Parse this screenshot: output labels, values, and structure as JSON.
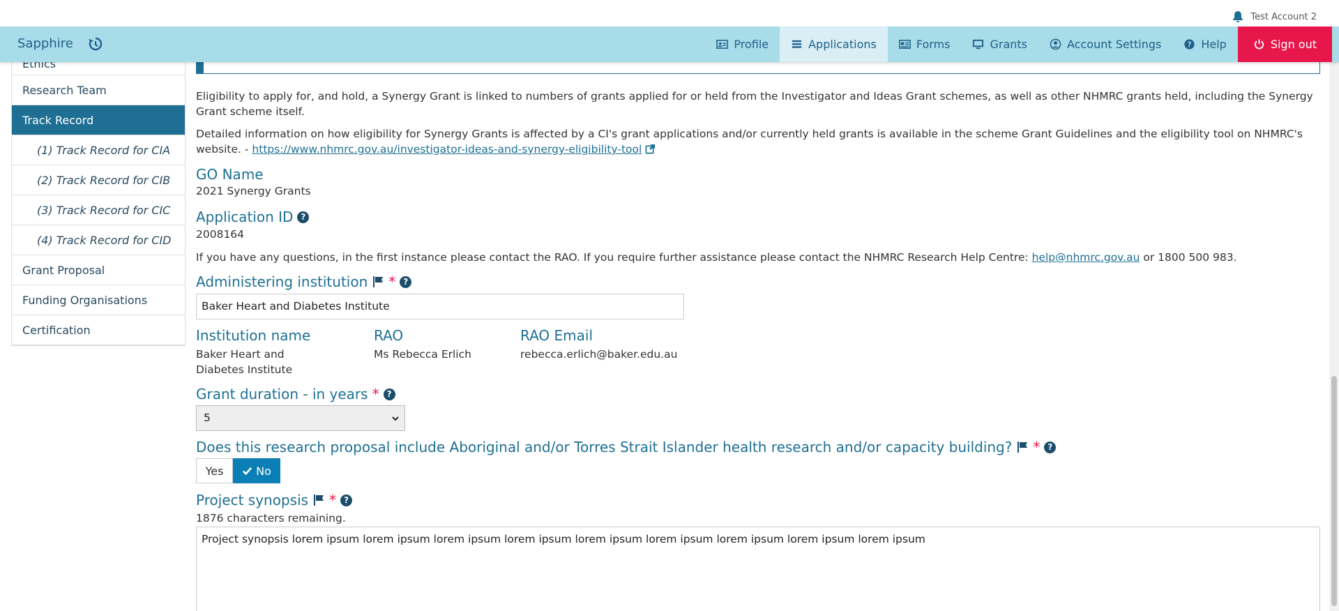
{
  "account": {
    "name": "Test Account 2"
  },
  "header": {
    "brand": "Sapphire",
    "nav": [
      {
        "label": "Profile",
        "icon": "id-card-icon"
      },
      {
        "label": "Applications",
        "icon": "list-icon"
      },
      {
        "label": "Forms",
        "icon": "newspaper-icon"
      },
      {
        "label": "Grants",
        "icon": "monitor-icon"
      },
      {
        "label": "Account Settings",
        "icon": "user-circle-icon"
      },
      {
        "label": "Help",
        "icon": "question-icon"
      },
      {
        "label": "Sign out",
        "icon": "power-icon"
      }
    ]
  },
  "sidebar": {
    "items": [
      {
        "label": "Ethics"
      },
      {
        "label": "Research Team"
      },
      {
        "label": "Track Record"
      },
      {
        "label": "(1) Track Record for CIA"
      },
      {
        "label": "(2) Track Record for CIB"
      },
      {
        "label": "(3) Track Record for CIC"
      },
      {
        "label": "(4) Track Record for CID"
      },
      {
        "label": "Grant Proposal"
      },
      {
        "label": "Funding Organisations"
      },
      {
        "label": "Certification"
      }
    ]
  },
  "main": {
    "eligibility_para": "Eligibility to apply for, and hold, a Synergy Grant is linked to numbers of grants applied for or held from the Investigator and Ideas Grant schemes, as well as other NHMRC grants held, including the Synergy Grant scheme itself.",
    "detail_para": "Detailed information on how eligibility for Synergy Grants is affected by a CI's grant applications and/or currently held grants is available in the scheme Grant Guidelines and the eligibility tool on NHMRC's website. - ",
    "eligibility_link": "https://www.nhmrc.gov.au/investigator-ideas-and-synergy-eligibility-tool",
    "go_name_label": "GO Name",
    "go_name_value": "2021 Synergy Grants",
    "app_id_label": "Application ID",
    "app_id_value": "2008164",
    "contact_pre": "If you have any questions, in the first instance please contact the RAO. If you require further assistance please contact the NHMRC Research Help Centre: ",
    "contact_email": "help@nhmrc.gov.au",
    "contact_post": " or 1800 500 983.",
    "admin_inst_label": "Administering institution",
    "admin_inst_value": "Baker Heart and Diabetes Institute",
    "inst_name_label": "Institution name",
    "inst_name_value": "Baker Heart and Diabetes Institute",
    "rao_label": "RAO",
    "rao_value": "Ms Rebecca Erlich",
    "rao_email_label": "RAO Email",
    "rao_email_value": "rebecca.erlich@baker.edu.au",
    "duration_label": "Grant duration - in years",
    "duration_value": "5",
    "atsi_question": "Does this research proposal include Aboriginal and/or Torres Strait Islander health research and/or capacity building?",
    "yes_label": "Yes",
    "no_label": "No",
    "synopsis_label": "Project synopsis",
    "synopsis_remaining": "1876 characters remaining.",
    "synopsis_value": "Project synopsis lorem ipsum lorem ipsum lorem ipsum lorem ipsum lorem ipsum lorem ipsum lorem ipsum lorem ipsum lorem ipsum",
    "required_mark": "*",
    "help_mark": "?"
  },
  "colors": {
    "header_bg": "#a9dce9",
    "accent": "#1e6f93",
    "signout": "#e8174b",
    "toggle_active": "#0b7fb5"
  }
}
